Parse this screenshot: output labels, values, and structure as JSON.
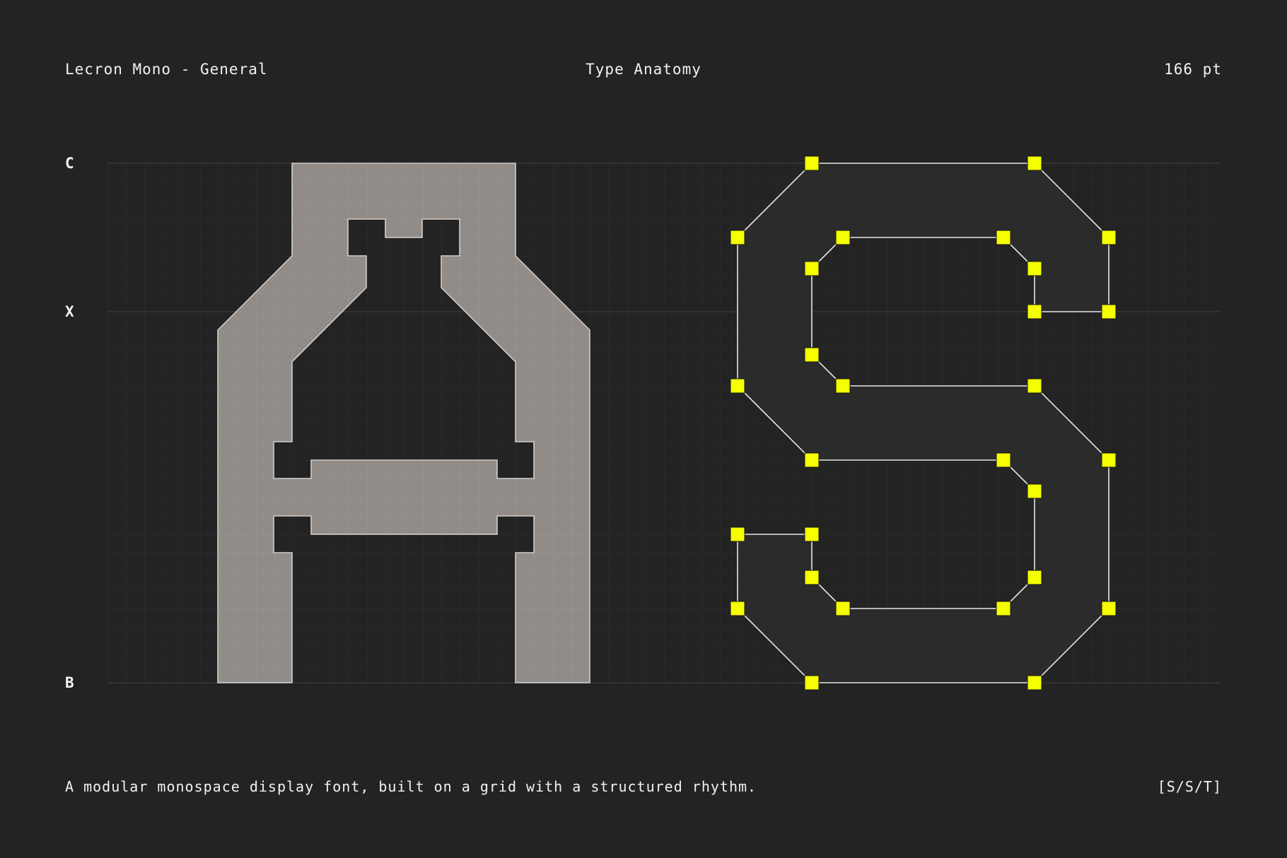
{
  "header": {
    "font_name": "Lecron Mono - General",
    "title": "Type Anatomy",
    "size": "166 pt"
  },
  "metrics": {
    "cap": "C",
    "xheight": "X",
    "baseline": "B"
  },
  "glyphs": {
    "letter_a": "A",
    "letter_s": "S"
  },
  "footer": {
    "description": "A modular monospace display font, built on a grid with a structured rhythm.",
    "tag": "[S/S/T]"
  },
  "colors": {
    "background": "#232323",
    "glyph_fill": "#918c88",
    "anchor": "#f5ff00",
    "outline": "#e6e6e6"
  }
}
